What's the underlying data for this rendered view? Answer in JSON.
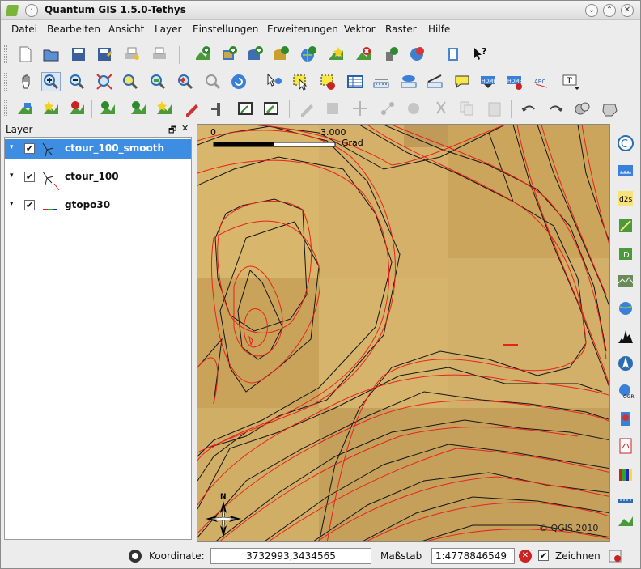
{
  "window": {
    "title": "Quantum GIS 1.5.0-Tethys",
    "minimize_glyph": "⌄",
    "maximize_glyph": "⌃",
    "close_glyph": "✕"
  },
  "menu": [
    "Datei",
    "Bearbeiten",
    "Ansicht",
    "Layer",
    "Einstellungen",
    "Erweiterungen",
    "Vektor",
    "Raster",
    "Hilfe"
  ],
  "layer_panel": {
    "title": "Layer",
    "float_glyph": "🗗",
    "close_glyph": "✕",
    "layers": [
      {
        "name": "ctour_100_smooth",
        "checked": "✔",
        "expand": "▾",
        "selected": true
      },
      {
        "name": "ctour_100",
        "checked": "✔",
        "expand": "▾",
        "selected": false
      },
      {
        "name": "gtopo30",
        "checked": "✔",
        "expand": "▾",
        "selected": false
      }
    ]
  },
  "map": {
    "scalebar_start": "0",
    "scalebar_end": "3.000",
    "scalebar_unit": "Grad",
    "north_label": "N",
    "copyright": "© QGIS 2010",
    "colors": {
      "smooth": "#e8221c",
      "contour": "#151515",
      "base": "#cfad63"
    }
  },
  "status": {
    "coord_label": "Koordinate:",
    "coord_value": "3732993,3434565",
    "scale_label": "Maßstab",
    "scale_value": "1:4778846549",
    "render_label": "Zeichnen",
    "render_checked": "✔"
  },
  "icons": [
    "new-project-icon",
    "open-project-icon",
    "save-project-icon",
    "save-as-icon",
    "print-composer-icon",
    "print-icon",
    "add-vector-icon",
    "add-raster-icon",
    "add-postgis-icon",
    "add-spatialite-icon",
    "add-wms-icon",
    "new-shapefile-icon",
    "remove-layer-icon",
    "add-wfs-icon",
    "gps-icon",
    "help-icon",
    "whats-this-icon"
  ]
}
